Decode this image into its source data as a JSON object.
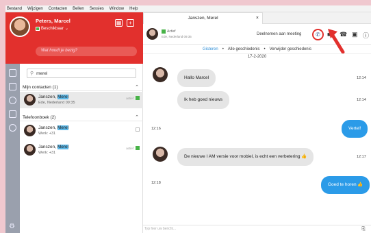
{
  "menu": [
    "Bestand",
    "Wijzigen",
    "Contacten",
    "Bellen",
    "Sessies",
    "Window",
    "Help"
  ],
  "user": {
    "name": "Peters, Marcel",
    "status": "Beschikbaar",
    "mood_placeholder": "Wat houdt je bezig?"
  },
  "search": {
    "value": "merel"
  },
  "sections": {
    "my_contacts": "Mijn contacten (1)",
    "phonebook": "Telefoonboek (2)"
  },
  "my_contacts": [
    {
      "name_prefix": "Janszen, ",
      "name_match": "Merel",
      "sub": "Ede, Nederland 09:35",
      "state": "actief"
    }
  ],
  "phonebook": [
    {
      "name_prefix": "Janszen, ",
      "name_match": "Merel",
      "sub": "Werk: +31",
      "state": ""
    },
    {
      "name_prefix": "Janszen, ",
      "name_match": "Merel",
      "sub": "Werk: +31",
      "state": "actief"
    }
  ],
  "chat": {
    "tab_title": "Janszen, Merel",
    "tab_close": "×",
    "contact_status": "Actief",
    "contact_location": "Ede, Nederland 09:35",
    "meeting_label": "Deelnemen aan meeting",
    "breadcrumbs": [
      "Gisteren",
      "Alle geschiedenis",
      "Verwijder geschiedenis"
    ],
    "date": "17-2-2020",
    "messages": [
      {
        "dir": "in",
        "text": "Hallo Marcel",
        "time": "12:14"
      },
      {
        "dir": "in",
        "text": "Ik heb goed nieuws",
        "time": "12:14"
      },
      {
        "dir": "out",
        "text": "Vertel!",
        "time": "12:16"
      },
      {
        "dir": "in",
        "text": "De nieuwe I AM versie voor mobiel, is echt een verbetering 👍",
        "time": "12:17"
      },
      {
        "dir": "out",
        "text": "Goed te horen 👍",
        "time": "12:18"
      }
    ],
    "composer_placeholder": "Typ hier uw bericht..."
  },
  "icons": {
    "call": "phone-icon",
    "video": "video-icon",
    "phone": "handset-icon",
    "screen": "screen-share-icon",
    "info": "info-icon"
  },
  "colors": {
    "brand_red": "#e2302d",
    "bubble_out": "#2b9be8",
    "bubble_in": "#e5e5e5",
    "status_green": "#48b348",
    "highlight": "#5db8e8"
  }
}
